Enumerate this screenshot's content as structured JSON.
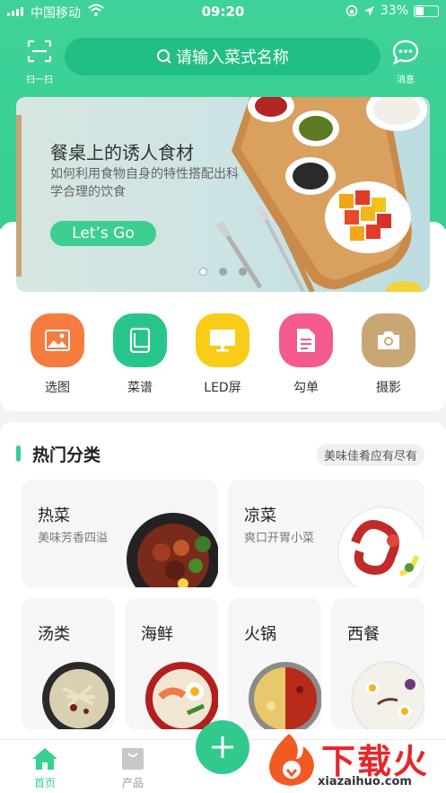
{
  "status": {
    "carrier": "中国移动",
    "time": "09:20",
    "battery": "33%"
  },
  "header": {
    "scan_label": "扫一扫",
    "search_placeholder": "请输入菜式名称",
    "message_label": "消息"
  },
  "banner": {
    "title": "餐桌上的诱人食材",
    "subtitle": "如何利用食物自身的特性搭配出科学合理的饮食",
    "button": "Let’s Go",
    "pages": 3,
    "active_page": 1
  },
  "quick_actions": [
    {
      "label": "选图",
      "icon": "image-icon",
      "color": "#f67b3f"
    },
    {
      "label": "菜谱",
      "icon": "book-icon",
      "color": "#27c58b"
    },
    {
      "label": "LED屏",
      "icon": "monitor-icon",
      "color": "#f8cc17"
    },
    {
      "label": "勾单",
      "icon": "document-icon",
      "color": "#f45a8c"
    },
    {
      "label": "摄影",
      "icon": "camera-icon",
      "color": "#c9a774"
    }
  ],
  "hot": {
    "title": "热门分类",
    "tag": "美味佳肴应有尽有",
    "big": [
      {
        "name": "热菜",
        "desc": "美味芳香四溢"
      },
      {
        "name": "凉菜",
        "desc": "爽口开胃小菜"
      }
    ],
    "small": [
      {
        "name": "汤类"
      },
      {
        "name": "海鲜"
      },
      {
        "name": "火锅"
      },
      {
        "name": "西餐"
      }
    ]
  },
  "tabs": [
    {
      "label": "首页",
      "active": true
    },
    {
      "label": "产品",
      "active": false
    }
  ],
  "watermark": {
    "title": "下载火",
    "url": "xiazaihuo.com"
  },
  "colors": {
    "brand": "#37cf93",
    "brand_dark": "#22bf85"
  }
}
